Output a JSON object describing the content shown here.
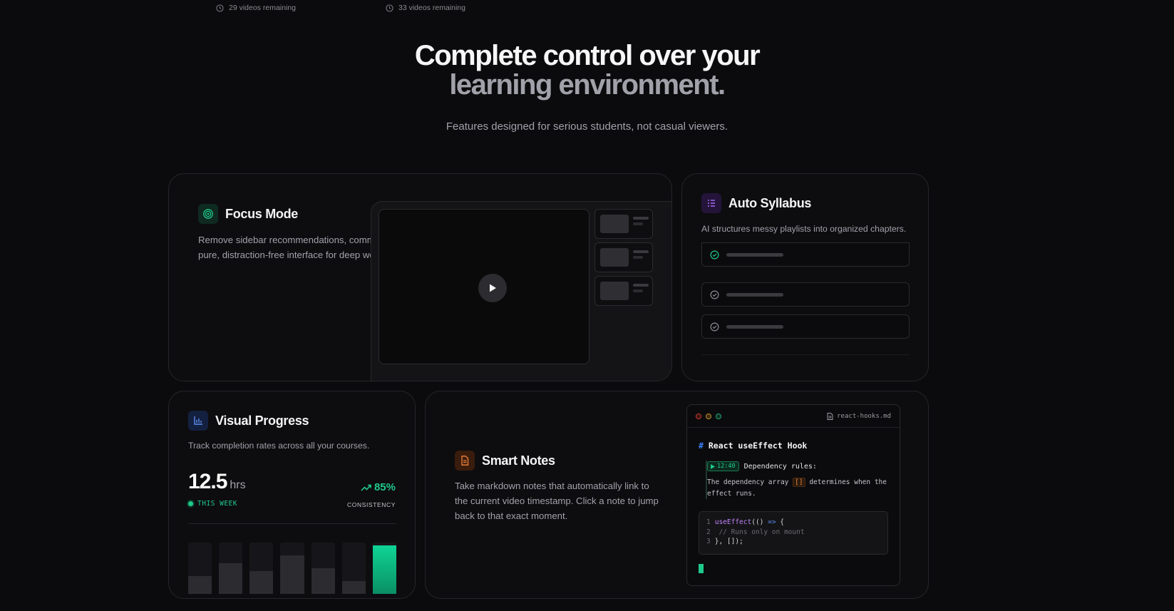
{
  "top": {
    "left_remaining": "29 videos remaining",
    "right_remaining": "33 videos remaining"
  },
  "hero": {
    "line1": "Complete control over your",
    "line2": "learning environment.",
    "subtitle": "Features designed for serious students, not casual viewers."
  },
  "focus": {
    "title": "Focus Mode",
    "desc_line1": "Remove sidebar recommendations, comme",
    "desc_line2": "pure, distraction-free interface for deep wo"
  },
  "syllabus": {
    "title": "Auto Syllabus",
    "desc": "AI structures messy playlists into organized chapters."
  },
  "progress": {
    "title": "Visual Progress",
    "desc": "Track completion rates across all your courses.",
    "hours": "12.5",
    "hours_unit": "hrs",
    "period": "THIS WEEK",
    "consistency": "85%",
    "consistency_label": "CONSISTENCY",
    "bar_levels": [
      0.35,
      0.6,
      0.45,
      0.75,
      0.5,
      0.25,
      0.95
    ],
    "accent": "#10b981"
  },
  "notes": {
    "title": "Smart Notes",
    "desc_line1": "Take markdown notes that automatically link to",
    "desc_line2": "the current video timestamp. Click a note to jump",
    "desc_line3": "back to that exact moment.",
    "filename": "react-hooks.md",
    "heading_hash": "#",
    "heading": "React useEffect Hook",
    "timestamp": "12:40",
    "rule_label": "Dependency rules:",
    "body_pre": "The dependency array",
    "body_code": "[]",
    "body_post": "determines when the",
    "body_line2": "effect runs.",
    "code_lines": [
      {
        "num": "1",
        "text": "useEffect(() => {"
      },
      {
        "num": "2",
        "text": "  // Runs only on mount"
      },
      {
        "num": "3",
        "text": "}, []);"
      }
    ]
  }
}
